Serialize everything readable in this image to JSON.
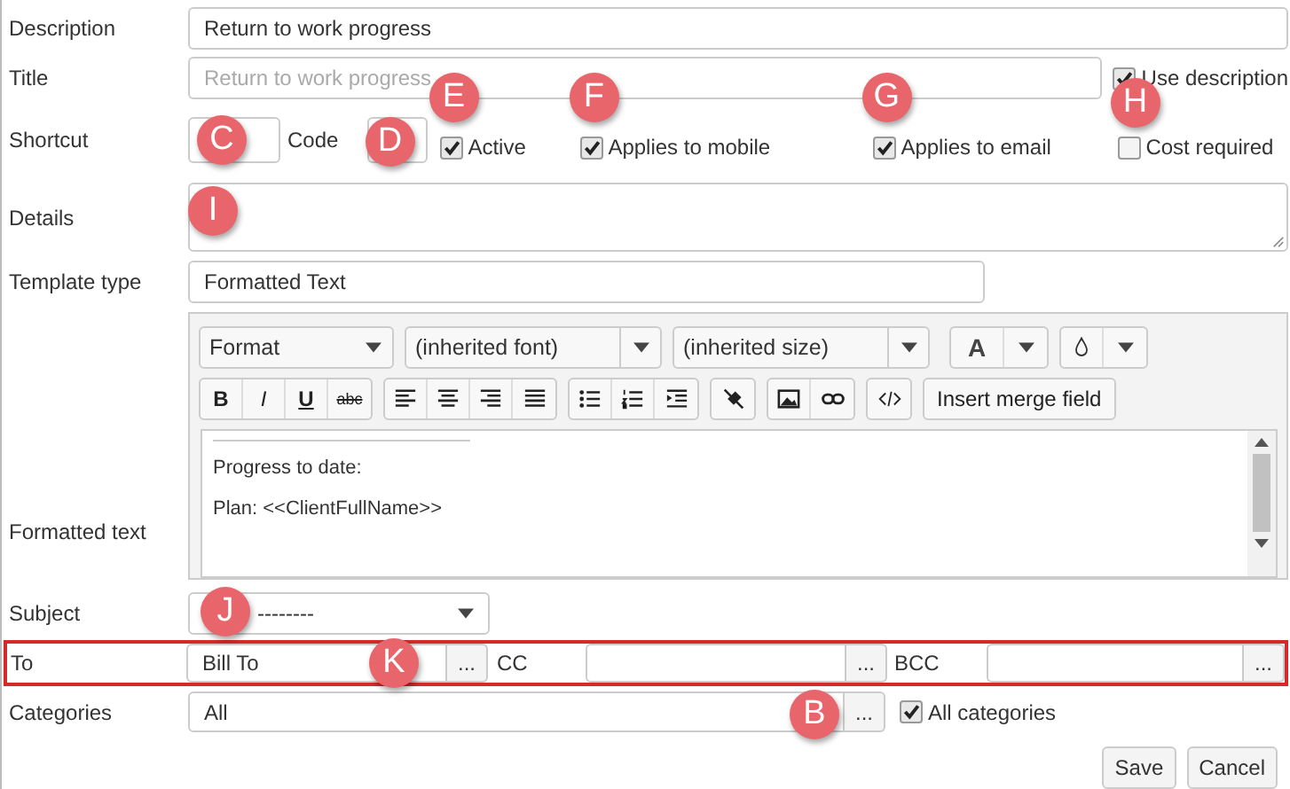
{
  "description": {
    "label": "Description",
    "value": "Return to work progress"
  },
  "title": {
    "label": "Title",
    "placeholder": "Return to work progress",
    "use_description": {
      "label": "Use description",
      "checked": true
    }
  },
  "shortcut": {
    "label": "Shortcut",
    "marker": "C"
  },
  "code": {
    "label": "Code",
    "marker": "D"
  },
  "flags": [
    {
      "label": "Active",
      "checked": true,
      "marker": "E"
    },
    {
      "label": "Applies to mobile",
      "checked": true,
      "marker": "F"
    },
    {
      "label": "Applies to email",
      "checked": true,
      "marker": "G"
    },
    {
      "label": "Cost required",
      "checked": false,
      "marker": "H"
    }
  ],
  "details": {
    "label": "Details",
    "marker": "I"
  },
  "template_type": {
    "label": "Template type",
    "value": "Formatted Text"
  },
  "editor": {
    "label": "Formatted text",
    "dropdowns": [
      "Format",
      "(inherited font)",
      "(inherited size)"
    ],
    "text_color_button": "A",
    "format_buttons": [
      {
        "text": "B",
        "kind": "bold"
      },
      {
        "text": "I",
        "kind": "italic"
      },
      {
        "text": "U",
        "kind": "underline"
      },
      {
        "text": "abc",
        "kind": "strike"
      }
    ],
    "merge_button": "Insert merge field",
    "paragraphs": [
      "Progress to date:",
      "Plan: <<ClientFullName>>"
    ]
  },
  "subject": {
    "label": "Subject",
    "value": "--------",
    "marker": "J"
  },
  "recipients": {
    "highlighted": true,
    "fields": [
      {
        "label": "To",
        "value": "Bill To",
        "button": "...",
        "marker": "K"
      },
      {
        "label": "CC",
        "button": "..."
      },
      {
        "label": "BCC",
        "button": "..."
      }
    ]
  },
  "categories": {
    "label": "Categories",
    "value": "All",
    "button": "...",
    "marker": "B",
    "all": {
      "label": "All categories",
      "checked": true
    }
  },
  "buttons": [
    "Save",
    "Cancel"
  ]
}
